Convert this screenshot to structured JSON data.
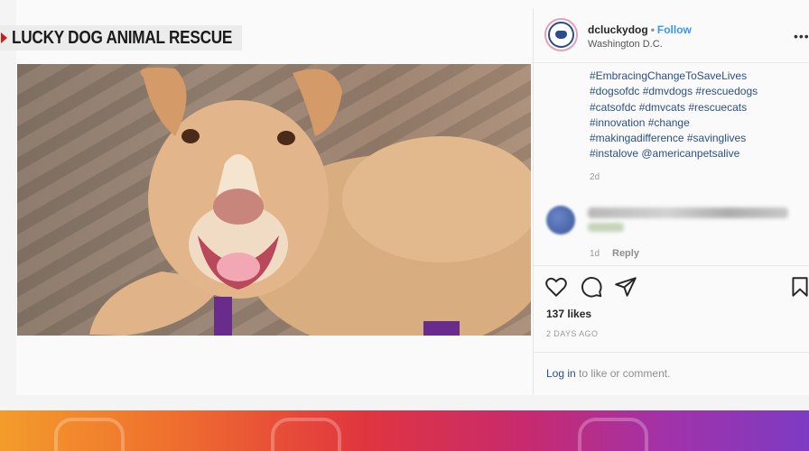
{
  "chyron": {
    "label": "LUCKY DOG ANIMAL RESCUE"
  },
  "post": {
    "username": "dcluckydog",
    "separator": "•",
    "follow_label": "Follow",
    "location": "Washington D.C.",
    "more_icon": "more-horizontal-icon",
    "caption_lines": [
      "#EmbracingChangeToSaveLives",
      "#dogsofdc #dmvdogs #rescuedogs",
      "#catsofdc #dmvcats #rescuecats",
      "#innovation #change",
      "#makingadifference #savinglives",
      "#instalove @americanpetsalive"
    ],
    "caption_age": "2d",
    "comment": {
      "age": "1d",
      "reply_label": "Reply"
    },
    "likes": "137 likes",
    "posted": "2 DAYS AGO",
    "login": {
      "link": "Log in",
      "rest": " to like or comment."
    }
  },
  "colors": {
    "accent": "#3897f0",
    "hashtag": "#2b4f86",
    "chyron_arrow": "#c81e1e"
  }
}
